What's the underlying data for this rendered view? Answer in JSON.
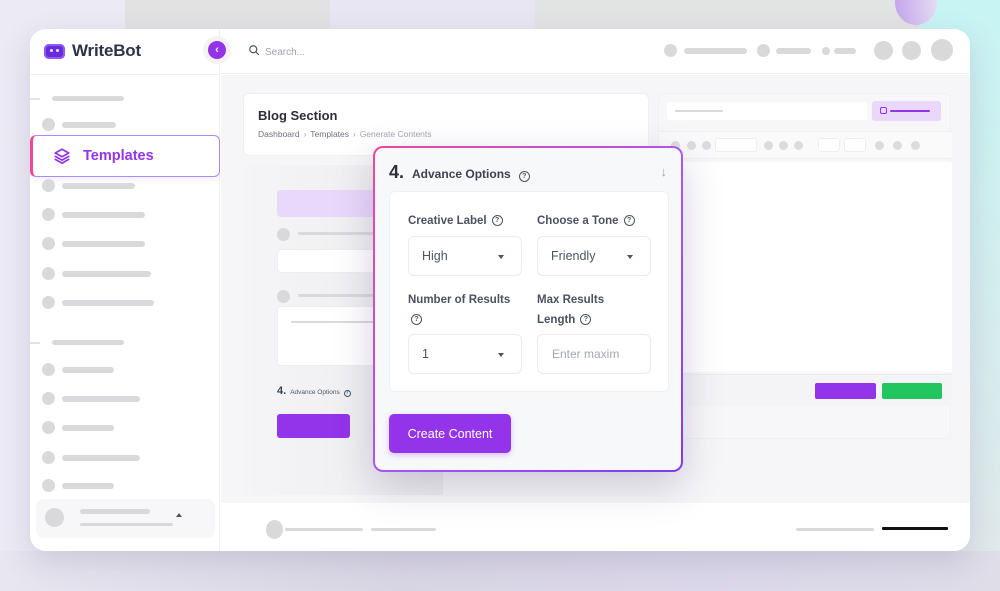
{
  "brand": {
    "name": "WriteBot",
    "logo_icon": "robot-icon"
  },
  "topbar": {
    "search_placeholder": "Search..."
  },
  "sidebar": {
    "active_item": {
      "label": "Templates",
      "icon": "layers-icon"
    }
  },
  "page": {
    "title": "Blog Section",
    "breadcrumb": [
      "Dashboard",
      "Templates",
      "Generate Contents"
    ]
  },
  "background_form": {
    "section_number": "4.",
    "section_title": "Advance Options"
  },
  "advance_options": {
    "number": "4.",
    "title": "Advance Options",
    "fields": {
      "creative_label": {
        "label": "Creative Label",
        "value": "High"
      },
      "tone": {
        "label": "Choose a Tone",
        "value": "Friendly"
      },
      "num_results": {
        "label": "Number of Results",
        "value": "1"
      },
      "max_length": {
        "label": "Max Results Length",
        "label_line1": "Max Results",
        "label_line2": "Length",
        "placeholder": "Enter maxim"
      }
    },
    "submit_label": "Create Content"
  },
  "colors": {
    "accent": "#9333ea",
    "success": "#22c55e",
    "gradient_start": "#ec4899",
    "gradient_end": "#7c3aed"
  }
}
